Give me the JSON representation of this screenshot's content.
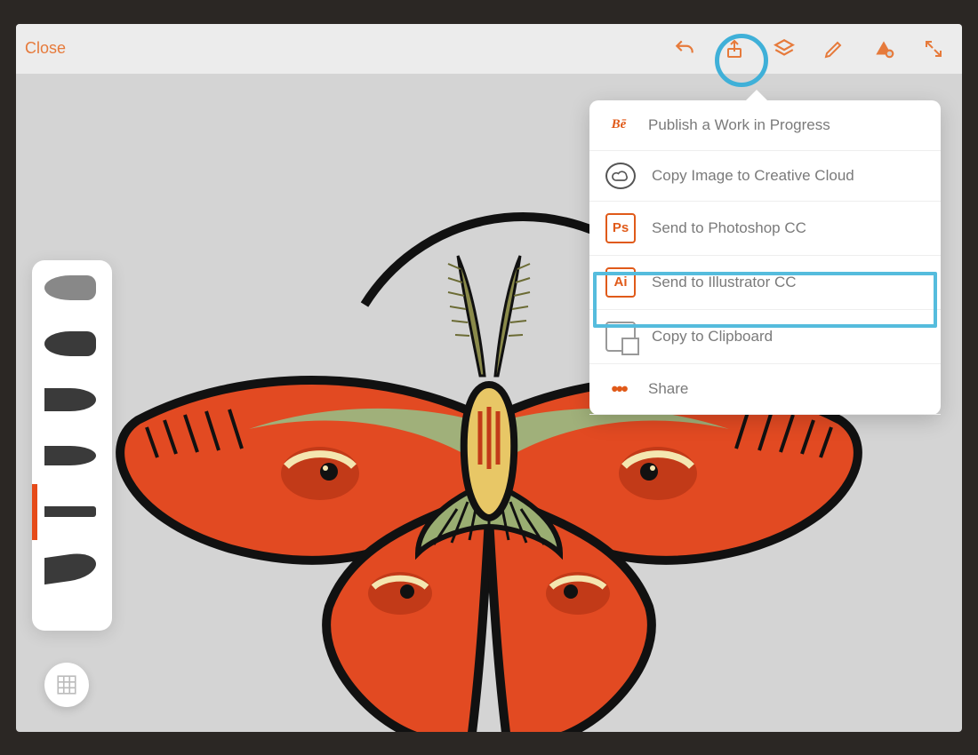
{
  "topbar": {
    "close_label": "Close",
    "tools": {
      "undo": "undo",
      "share": "share",
      "layers": "layers",
      "draw": "draw",
      "shapes": "shapes",
      "fullscreen": "fullscreen"
    }
  },
  "share_menu": {
    "items": [
      {
        "icon": "behance",
        "label": "Publish a Work in Progress"
      },
      {
        "icon": "creative-cloud",
        "label": "Copy Image to Creative Cloud"
      },
      {
        "icon": "photoshop",
        "label": "Send to Photoshop CC"
      },
      {
        "icon": "illustrator",
        "label": "Send to Illustrator CC"
      },
      {
        "icon": "clipboard",
        "label": "Copy to Clipboard"
      },
      {
        "icon": "more",
        "label": "Share"
      }
    ],
    "highlighted_index": 3
  },
  "palette": {
    "brushes": [
      "round-soft",
      "round-hard",
      "taper-1",
      "taper-2",
      "marker",
      "chisel"
    ],
    "active_brush_index": 4,
    "active_color": "#e64a19"
  },
  "annotation": {
    "share_circled": true
  }
}
